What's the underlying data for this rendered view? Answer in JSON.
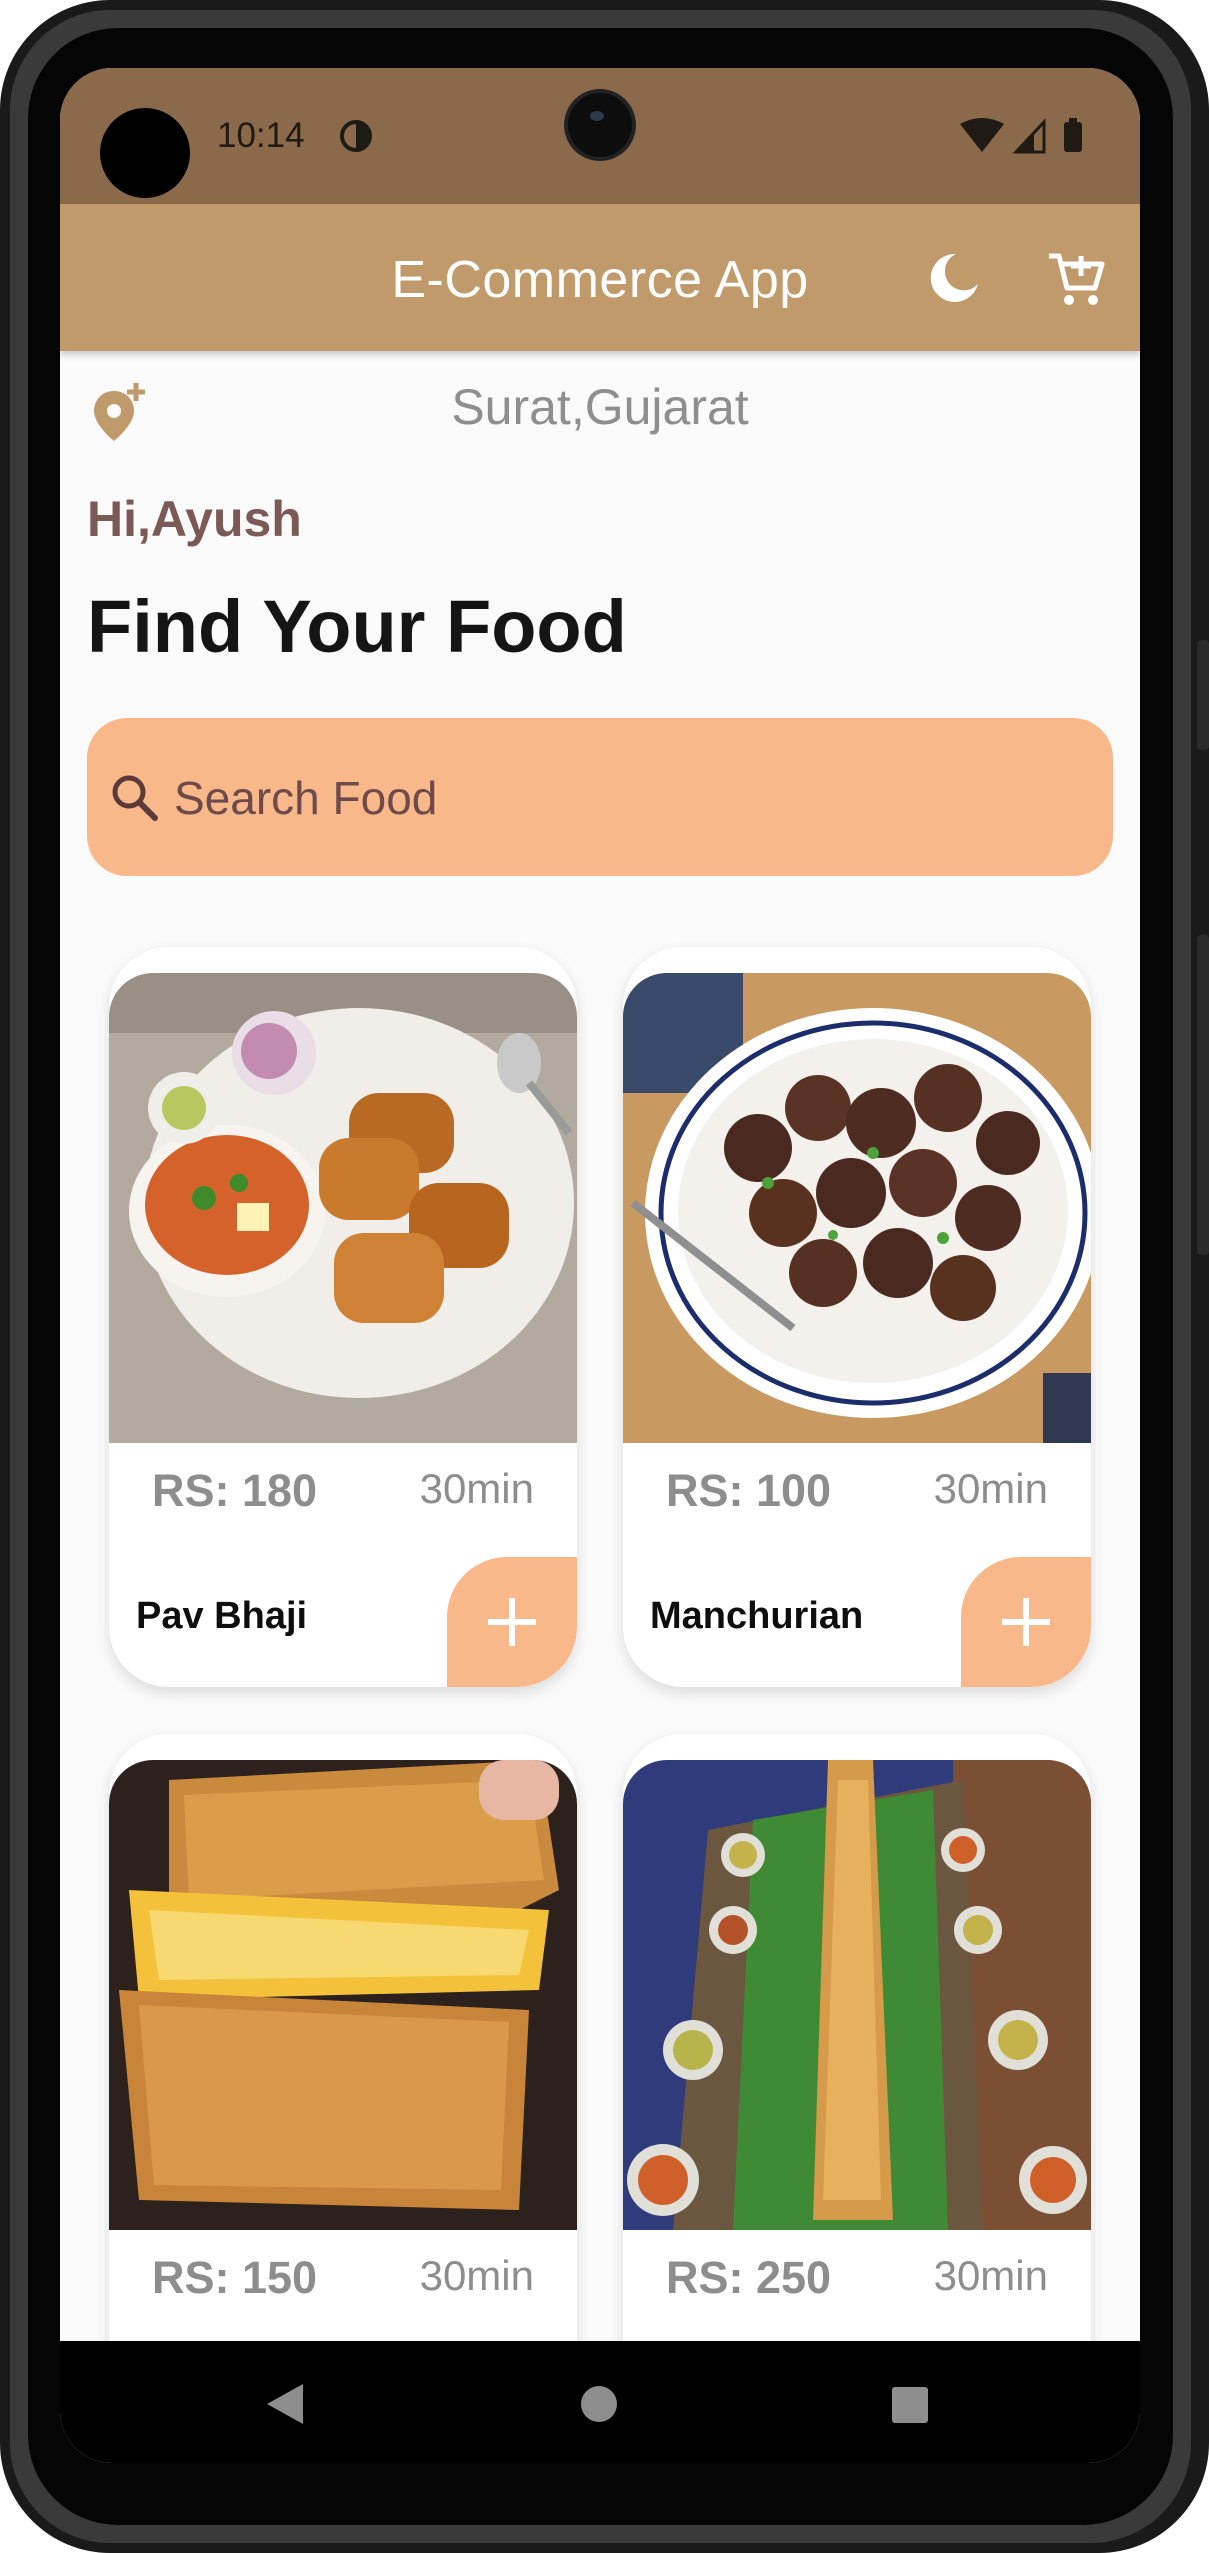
{
  "status_bar": {
    "time": "10:14"
  },
  "app_bar": {
    "title": "E-Commerce App"
  },
  "location": {
    "text": "Surat,Gujarat"
  },
  "greeting": "Hi,Ayush",
  "headline": "Find Your Food",
  "search": {
    "placeholder": "Search Food",
    "value": ""
  },
  "foods": [
    {
      "name": "Pav Bhaji",
      "price": "RS: 180",
      "time": "30min"
    },
    {
      "name": "Manchurian",
      "price": "RS: 100",
      "time": "30min"
    },
    {
      "name": "",
      "price": "RS: 150",
      "time": "30min"
    },
    {
      "name": "",
      "price": "RS: 250",
      "time": "30min"
    }
  ],
  "colors": {
    "status_bar": "#8a6a4a",
    "app_bar": "#c19a6b",
    "accent": "#f8b88a",
    "greeting": "#7b5a55"
  },
  "icons": [
    "location-add-icon",
    "moon-icon",
    "cart-icon",
    "search-icon",
    "plus-icon",
    "back-icon",
    "home-icon",
    "recents-icon"
  ]
}
